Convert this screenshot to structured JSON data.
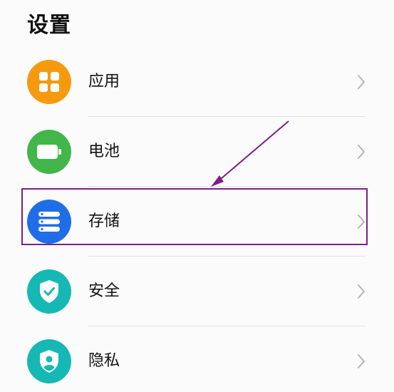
{
  "header": {
    "title": "设置"
  },
  "settings": {
    "items": [
      {
        "label": "应用",
        "icon": "apps-grid-icon",
        "color": "#f59a0f"
      },
      {
        "label": "电池",
        "icon": "battery-icon",
        "color": "#43b649"
      },
      {
        "label": "存储",
        "icon": "storage-icon",
        "color": "#1f6ee8"
      },
      {
        "label": "安全",
        "icon": "shield-check-icon",
        "color": "#16b8b4"
      },
      {
        "label": "隐私",
        "icon": "privacy-shield-icon",
        "color": "#16b8b4"
      }
    ]
  },
  "annotation": {
    "highlight_color": "#7b1f86",
    "highlighted_item": "存储"
  }
}
